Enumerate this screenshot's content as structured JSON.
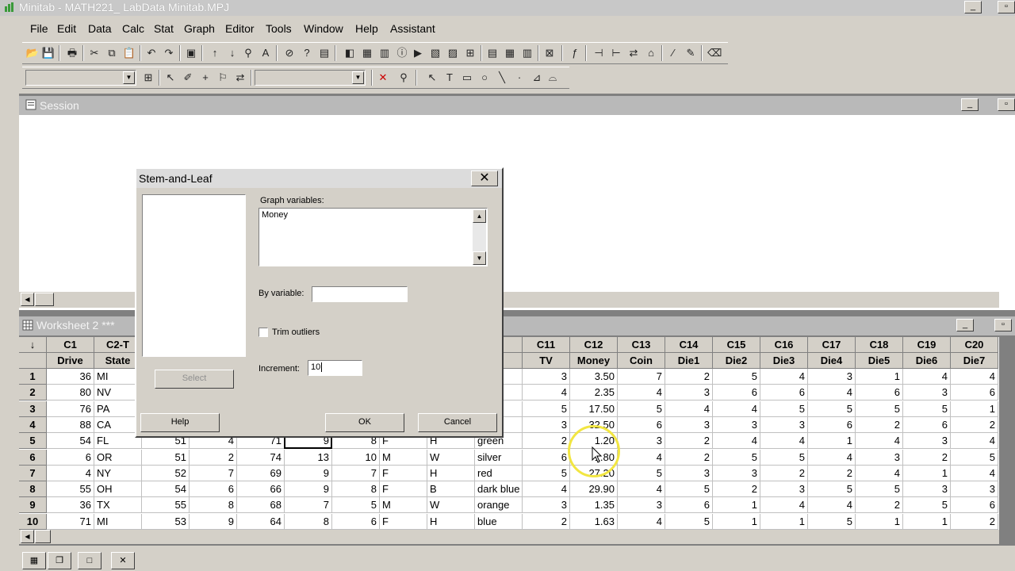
{
  "window": {
    "title": "Minitab - MATH221_ LabData Minitab.MPJ"
  },
  "menu": [
    "File",
    "Edit",
    "Data",
    "Calc",
    "Stat",
    "Graph",
    "Editor",
    "Tools",
    "Window",
    "Help",
    "Assistant"
  ],
  "session": {
    "title": "Session"
  },
  "worksheet": {
    "title": "Worksheet 2 ***",
    "corner": "↓",
    "columns": [
      {
        "id": "C1",
        "name": "Drive"
      },
      {
        "id": "C2-T",
        "name": "State"
      },
      {
        "id": "",
        "name": ""
      },
      {
        "id": "",
        "name": ""
      },
      {
        "id": "",
        "name": ""
      },
      {
        "id": "",
        "name": ""
      },
      {
        "id": "",
        "name": ""
      },
      {
        "id": "",
        "name": ""
      },
      {
        "id": "",
        "name": ""
      },
      {
        "id": "-T",
        "name": "r"
      },
      {
        "id": "C11",
        "name": "TV"
      },
      {
        "id": "C12",
        "name": "Money"
      },
      {
        "id": "C13",
        "name": "Coin"
      },
      {
        "id": "C14",
        "name": "Die1"
      },
      {
        "id": "C15",
        "name": "Die2"
      },
      {
        "id": "C16",
        "name": "Die3"
      },
      {
        "id": "C17",
        "name": "Die4"
      },
      {
        "id": "C18",
        "name": "Die5"
      },
      {
        "id": "C19",
        "name": "Die6"
      },
      {
        "id": "C20",
        "name": "Die7"
      }
    ],
    "rows": [
      [
        "1",
        "36",
        "MI",
        "",
        "",
        "",
        "",
        "",
        "",
        "",
        "",
        "3",
        "3.50",
        "7",
        "2",
        "5",
        "4",
        "3",
        "1",
        "4",
        "4"
      ],
      [
        "2",
        "80",
        "NV",
        "",
        "",
        "",
        "",
        "",
        "",
        "",
        "",
        "4",
        "2.35",
        "4",
        "3",
        "6",
        "6",
        "4",
        "6",
        "3",
        "6"
      ],
      [
        "3",
        "76",
        "PA",
        "",
        "",
        "",
        "",
        "",
        "",
        "",
        "",
        "5",
        "17.50",
        "5",
        "4",
        "4",
        "5",
        "5",
        "5",
        "5",
        "1"
      ],
      [
        "4",
        "88",
        "CA",
        "",
        "",
        "",
        "",
        "",
        "",
        "",
        "",
        "3",
        "32.50",
        "6",
        "3",
        "3",
        "3",
        "6",
        "2",
        "6",
        "2"
      ],
      [
        "5",
        "54",
        "FL",
        "51",
        "4",
        "71",
        "9",
        "8",
        "F",
        "H",
        "green",
        "2",
        "1.20",
        "3",
        "2",
        "4",
        "4",
        "1",
        "4",
        "3",
        "4"
      ],
      [
        "6",
        "6",
        "OR",
        "51",
        "2",
        "74",
        "13",
        "10",
        "M",
        "W",
        "silver",
        "6",
        "1.80",
        "4",
        "2",
        "5",
        "5",
        "4",
        "3",
        "2",
        "5"
      ],
      [
        "7",
        "4",
        "NY",
        "52",
        "7",
        "69",
        "9",
        "7",
        "F",
        "H",
        "red",
        "5",
        "27.20",
        "5",
        "3",
        "3",
        "2",
        "2",
        "4",
        "1",
        "4"
      ],
      [
        "8",
        "55",
        "OH",
        "54",
        "6",
        "66",
        "9",
        "8",
        "F",
        "B",
        "dark blue",
        "4",
        "29.90",
        "4",
        "5",
        "2",
        "3",
        "5",
        "5",
        "3",
        "3"
      ],
      [
        "9",
        "36",
        "TX",
        "55",
        "8",
        "68",
        "7",
        "5",
        "M",
        "W",
        "orange",
        "3",
        "1.35",
        "3",
        "6",
        "1",
        "4",
        "4",
        "2",
        "5",
        "6"
      ],
      [
        "10",
        "71",
        "MI",
        "53",
        "9",
        "64",
        "8",
        "6",
        "F",
        "H",
        "blue",
        "2",
        "1.63",
        "4",
        "5",
        "1",
        "1",
        "5",
        "1",
        "1",
        "2"
      ]
    ]
  },
  "dialog": {
    "title": "Stem-and-Leaf",
    "close": "✕",
    "graph_variables_label": "Graph variables:",
    "graph_variables_value": "Money",
    "by_variable_label": "By variable:",
    "by_variable_value": "",
    "trim_outliers_label": "Trim outliers",
    "trim_outliers_checked": false,
    "increment_label": "Increment:",
    "increment_value": "10",
    "select_button": "Select",
    "help_button": "Help",
    "ok_button": "OK",
    "cancel_button": "Cancel"
  }
}
